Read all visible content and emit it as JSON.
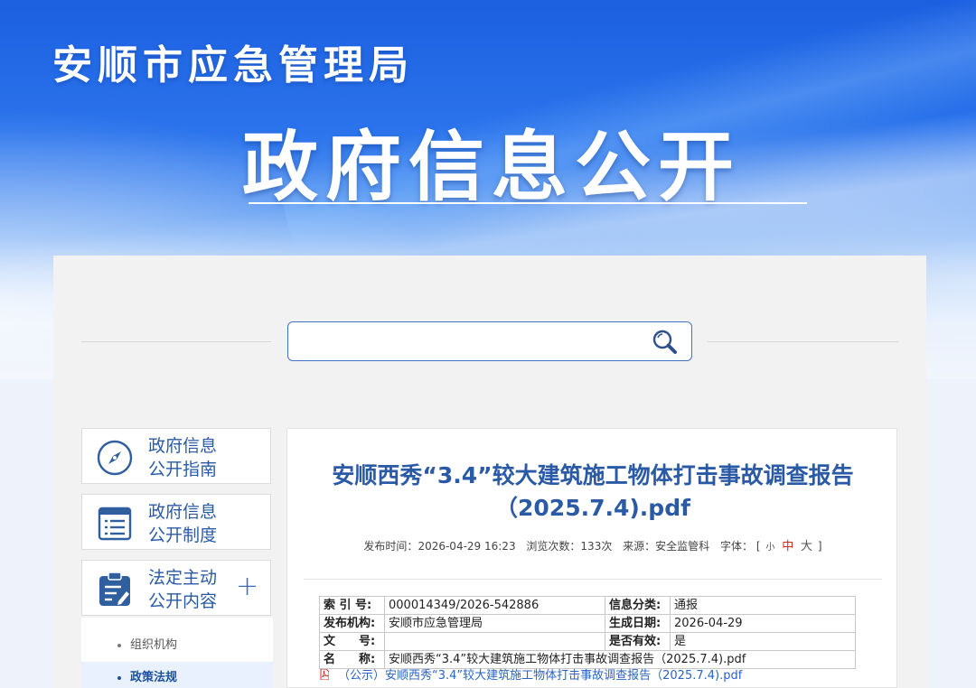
{
  "header": {
    "org_name": "安顺市应急管理局",
    "section_title": "政府信息公开"
  },
  "search": {
    "placeholder": "",
    "icon": "search-icon"
  },
  "sidebar": {
    "cards": [
      {
        "icon": "compass-icon",
        "line1": "政府信息",
        "line2": "公开指南"
      },
      {
        "icon": "list-icon",
        "line1": "政府信息",
        "line2": "公开制度"
      },
      {
        "icon": "clipboard-icon",
        "line1": "法定主动",
        "line2": "公开内容",
        "expand": "+"
      }
    ],
    "submenu": [
      {
        "label": "组织机构",
        "active": false
      },
      {
        "label": "政策法规",
        "active": true
      }
    ]
  },
  "article": {
    "title": "安顺西秀“3.4”较大建筑施工物体打击事故调查报告（2025.7.4).pdf",
    "meta": {
      "publish_label": "发布时间：",
      "publish_time": "2026-04-29 16:23",
      "views_label": "浏览次数：",
      "views": "133次",
      "source_label": "来源：",
      "source": "安全监管科",
      "font_label": "字体：",
      "bracket_open": "[",
      "font_small": "小",
      "font_medium": "中",
      "font_large": "大",
      "bracket_close": "]"
    },
    "info_table": {
      "index_label": "索 引 号:",
      "index_value": "000014349/2026-542886",
      "category_label": "信息分类:",
      "category_value": "通报",
      "publisher_label": "发布机构:",
      "publisher_value": "安顺市应急管理局",
      "date_label": "生成日期:",
      "date_value": "2026-04-29",
      "doc_no_label": "文　　号:",
      "doc_no_value": "",
      "valid_label": "是否有效:",
      "valid_value": "是",
      "name_label": "名　　称:",
      "name_value": "安顺西秀“3.4”较大建筑施工物体打击事故调查报告（2025.7.4).pdf"
    },
    "attachment": {
      "icon": "pdf-icon",
      "label": "（公示）安顺西秀“3.4”较大建筑施工物体打击事故调查报告（2025.7.4).pdf"
    }
  },
  "colors": {
    "brand_blue": "#2a5aa6",
    "link_blue": "#2a63c2",
    "accent_red": "#d4261b"
  }
}
